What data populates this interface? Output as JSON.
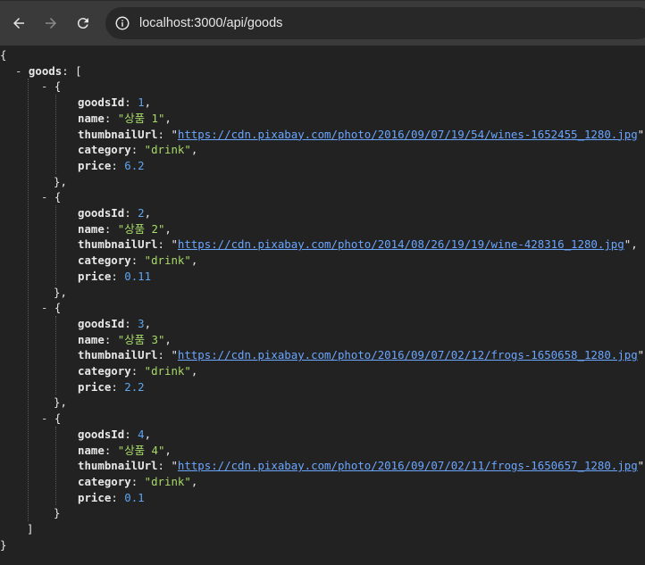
{
  "browser": {
    "url": "localhost:3000/api/goods"
  },
  "json": {
    "root_key": "goods",
    "items": [
      {
        "goodsId": "1",
        "name": "\"상품 1\"",
        "thumbnailUrl": "https://cdn.pixabay.com/photo/2016/09/07/19/54/wines-1652455_1280.jpg",
        "category": "\"drink\"",
        "price": "6.2"
      },
      {
        "goodsId": "2",
        "name": "\"상품 2\"",
        "thumbnailUrl": "https://cdn.pixabay.com/photo/2014/08/26/19/19/wine-428316_1280.jpg",
        "category": "\"drink\"",
        "price": "0.11"
      },
      {
        "goodsId": "3",
        "name": "\"상품 3\"",
        "thumbnailUrl": "https://cdn.pixabay.com/photo/2016/09/07/02/12/frogs-1650658_1280.jpg",
        "category": "\"drink\"",
        "price": "2.2"
      },
      {
        "goodsId": "4",
        "name": "\"상품 4\"",
        "thumbnailUrl": "https://cdn.pixabay.com/photo/2016/09/07/02/11/frogs-1650657_1280.jpg",
        "category": "\"drink\"",
        "price": "0.1"
      }
    ]
  },
  "icons": {
    "back": "arrow-left-icon",
    "forward": "arrow-right-icon",
    "reload": "reload-icon",
    "info": "info-icon"
  }
}
